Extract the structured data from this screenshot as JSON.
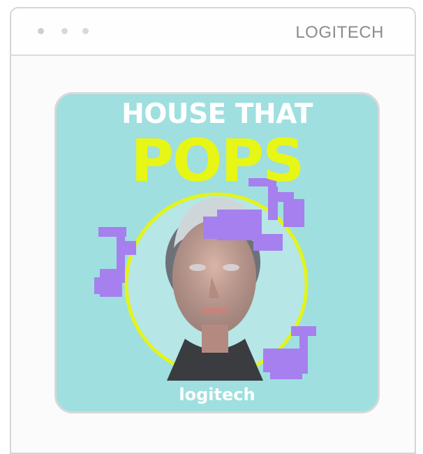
{
  "window": {
    "brand_label": "LOGITECH"
  },
  "cover": {
    "title_line1": "HOUSE THAT",
    "title_line2": "POPS",
    "footer_logo": "logitech"
  },
  "colors": {
    "cover_background": "#9fdfe0",
    "title_white": "#ffffff",
    "title_yellow": "#e7f615",
    "ring": "#e3f41a",
    "notes": "#a680ee"
  },
  "icons": [
    "window-dot-icon",
    "music-note-icon"
  ]
}
